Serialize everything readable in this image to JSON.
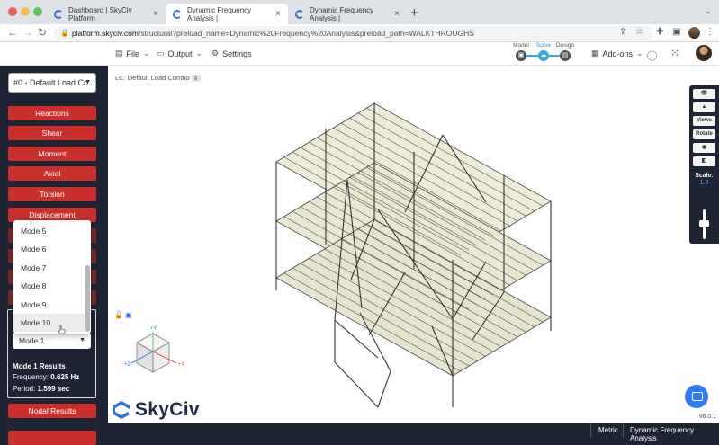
{
  "browser": {
    "tabs": [
      {
        "title": "Dashboard | SkyCiv Platform",
        "active": false
      },
      {
        "title": "Dynamic Frequency Analysis |",
        "active": true
      },
      {
        "title": "Dynamic Frequency Analysis |",
        "active": false
      }
    ],
    "url_host": "platform.skyciv.com",
    "url_path": "/structural?preload_name=Dynamic%20Frequency%20Analysis&preload_path=WALKTHROUGHS"
  },
  "toolbar": {
    "file_label": "File",
    "output_label": "Output",
    "settings_label": "Settings",
    "stages": [
      "Model",
      "Solve",
      "Design"
    ],
    "addons_label": "Add-ons"
  },
  "sidebar": {
    "combo_label": "#0 - Default Load Co...",
    "buttons": [
      "Reactions",
      "Shear",
      "Moment",
      "Axial",
      "Torsion",
      "Displacement"
    ],
    "mode_dropdown": {
      "options": [
        "Mode 5",
        "Mode 6",
        "Mode 7",
        "Mode 8",
        "Mode 9",
        "Mode 10"
      ],
      "hovered": "Mode 10"
    },
    "mode_selected": "Mode 1",
    "results": {
      "title": "Mode 1 Results",
      "frequency_label": "Frequency:",
      "frequency_value": "0.625 Hz",
      "period_label": "Period:",
      "period_value": "1.599 sec"
    },
    "nodal_results_label": "Nodal Results"
  },
  "canvas": {
    "lc_label": "LC: Default Load Combo",
    "right_tools": {
      "views_label": "Views",
      "rotate_label": "Rotate",
      "scale_label": "Scale:",
      "scale_value": "1.0"
    },
    "axes": {
      "y": "+Y",
      "x": "+X",
      "z": "+Z"
    },
    "logo_text": "SkyCiv",
    "version": "v6.0.1"
  },
  "statusbar": {
    "units": "Metric",
    "analysis": "Dynamic Frequency Analysis"
  },
  "colors": {
    "accent_red": "#c9302c",
    "sidebar_bg": "#1e2433",
    "accent_blue": "#39a8dc"
  }
}
